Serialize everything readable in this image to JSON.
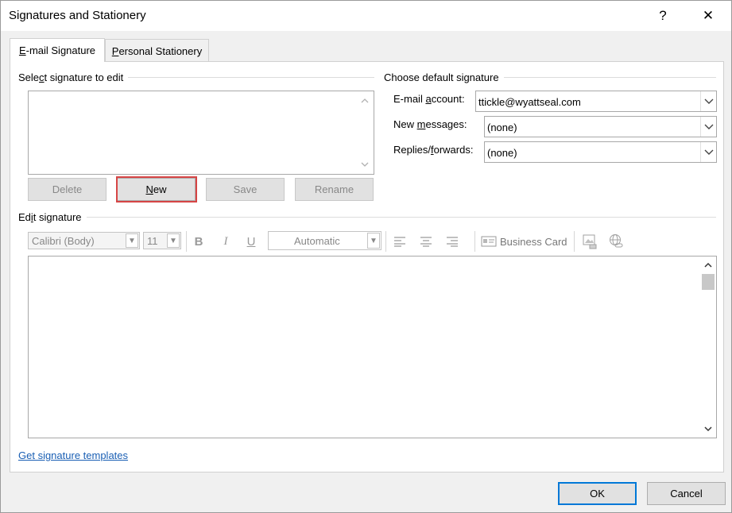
{
  "window": {
    "title": "Signatures and Stationery",
    "help_label": "?",
    "close_label": "✕"
  },
  "tabs": [
    {
      "pre": "",
      "key": "E",
      "post": "-mail Signature",
      "active": true
    },
    {
      "pre": "",
      "key": "P",
      "post": "ersonal Stationery",
      "active": false
    }
  ],
  "select_signature": {
    "label_pre": "Sele",
    "label_key": "c",
    "label_post": "t signature to edit",
    "items": []
  },
  "buttons": {
    "delete": "Delete",
    "new_key": "N",
    "new_post": "ew",
    "save": "Save",
    "rename": "Rename"
  },
  "default_signature": {
    "label": "Choose default signature",
    "email_account_label_pre": "E-mail ",
    "email_account_label_key": "a",
    "email_account_label_post": "ccount:",
    "email_account_value": "ttickle@wyattseal.com",
    "new_messages_label_pre": "New ",
    "new_messages_label_key": "m",
    "new_messages_label_post": "essages:",
    "new_messages_value": "(none)",
    "replies_label_pre": "Replies/",
    "replies_label_key": "f",
    "replies_label_post": "orwards:",
    "replies_value": "(none)"
  },
  "edit_signature": {
    "label_pre": "Ed",
    "label_key": "i",
    "label_post": "t signature",
    "font": "Calibri (Body)",
    "size": "11",
    "bold": "B",
    "italic": "I",
    "underline": "U",
    "color": "Automatic",
    "business_card": "Business Card"
  },
  "link": "Get signature templates",
  "footer": {
    "ok": "OK",
    "cancel": "Cancel"
  },
  "colors": {
    "accent": "#0078d7",
    "highlight": "#d64545",
    "link": "#1a5fb4"
  }
}
